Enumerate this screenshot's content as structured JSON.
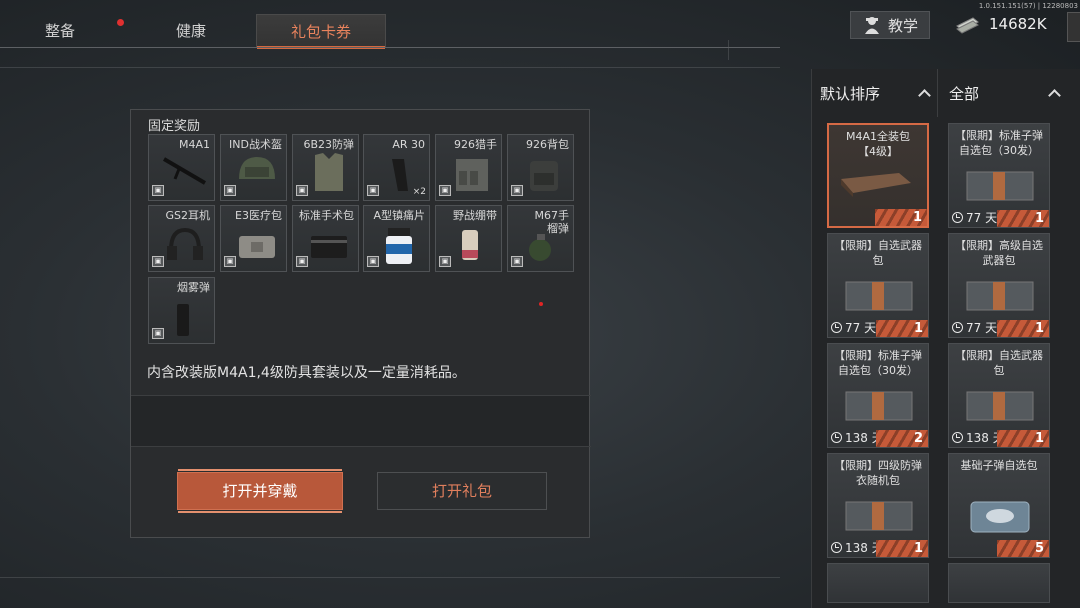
{
  "version": "1.0.151.151(57) | 12280803",
  "tabs": [
    {
      "label": "整备",
      "active": false
    },
    {
      "label": "健康",
      "active": false
    },
    {
      "label": "礼包卡券",
      "active": true
    }
  ],
  "header": {
    "teach_label": "教学",
    "currency": "14682K",
    "currency_icon": "cash-stack-icon",
    "teach_icon": "instructor-icon"
  },
  "dialog": {
    "section_title": "固定奖励",
    "items": [
      {
        "name": "M4A1",
        "icon": "rifle-icon"
      },
      {
        "name": "IND战术盔",
        "icon": "helmet-icon"
      },
      {
        "name": "6B23防弹",
        "icon": "body-armor-icon"
      },
      {
        "name": "AR 30",
        "icon": "magazine-icon",
        "qty": "×2"
      },
      {
        "name": "926猎手",
        "icon": "chest-rig-icon"
      },
      {
        "name": "926背包",
        "icon": "backpack-icon"
      },
      {
        "name": "GS2耳机",
        "icon": "headset-icon"
      },
      {
        "name": "E3医疗包",
        "icon": "medkit-icon"
      },
      {
        "name": "标准手术包",
        "icon": "surgery-kit-icon"
      },
      {
        "name": "A型镇痛片",
        "icon": "pill-bottle-icon"
      },
      {
        "name": "野战绷带",
        "icon": "bandage-icon"
      },
      {
        "name": "M67手榴弹",
        "icon": "grenade-icon"
      },
      {
        "name": "烟雾弹",
        "icon": "smoke-grenade-icon"
      }
    ],
    "description": "内含改装版M4A1,4级防具套装以及一定量消耗品。",
    "primary_button": "打开并穿戴",
    "secondary_button": "打开礼包"
  },
  "panel": {
    "sort_label": "默认排序",
    "filter_label": "全部",
    "cards": [
      {
        "name": "M4A1全装包\n【4级】",
        "days": "",
        "count": "1",
        "selected": true
      },
      {
        "name": "【限期】标准子弹自选包（30发）",
        "days": "77 天",
        "count": "1",
        "selected": false
      },
      {
        "name": "【限期】自选武器包",
        "days": "77 天",
        "count": "1",
        "selected": false
      },
      {
        "name": "【限期】高级自选武器包",
        "days": "77 天",
        "count": "1",
        "selected": false
      },
      {
        "name": "【限期】标准子弹自选包（30发）",
        "days": "138 天",
        "count": "2",
        "selected": false
      },
      {
        "name": "【限期】自选武器包",
        "days": "138 天",
        "count": "1",
        "selected": false
      },
      {
        "name": "【限期】四级防弹衣随机包",
        "days": "138 天",
        "count": "1",
        "selected": false
      },
      {
        "name": "基础子弹自选包",
        "days": "",
        "count": "5",
        "selected": false
      }
    ]
  }
}
